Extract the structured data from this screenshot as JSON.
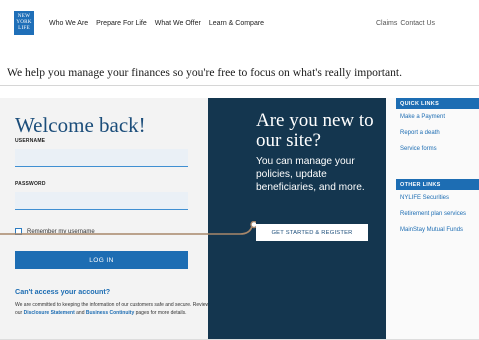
{
  "logo": {
    "line1": "NEW",
    "line2": "YORK",
    "line3": "LIFE"
  },
  "nav": {
    "items": [
      "Who We Are",
      "Prepare For Life",
      "What We Offer",
      "Learn & Compare"
    ],
    "claims": "Claims",
    "contact": "Contact Us"
  },
  "tagline": "We help you manage your finances so you're free to focus on what's really important.",
  "login": {
    "title": "Welcome back!",
    "username_label": "USERNAME",
    "username_value": "",
    "password_label": "PASSWORD",
    "password_value": "",
    "remember_label": "Remember my username",
    "login_button": "LOG IN",
    "cant_access": "Can't access your account?",
    "commit_text_1": "We are committed to keeping the information of our customers safe and secure. Review our ",
    "disclosure_link": "Disclosure Statement",
    "commit_and": " and ",
    "continuity_link": "Business Continuity",
    "commit_text_2": " pages for more details."
  },
  "register": {
    "title": "Are you new to our site?",
    "subtitle": "You can manage your policies, update beneficiaries, and more.",
    "button": "GET STARTED & REGISTER"
  },
  "quick_links": {
    "header": "QUICK LINKS",
    "items": [
      "Make a Payment",
      "Report a death",
      "Service forms"
    ]
  },
  "other_links": {
    "header": "OTHER LINKS",
    "items": [
      "NYLIFE Securities",
      "Retirement plan services",
      "MainStay Mutual Funds"
    ]
  },
  "colors": {
    "brand_blue": "#1d6db3",
    "navy": "#14364f",
    "connector": "#a8876a"
  }
}
